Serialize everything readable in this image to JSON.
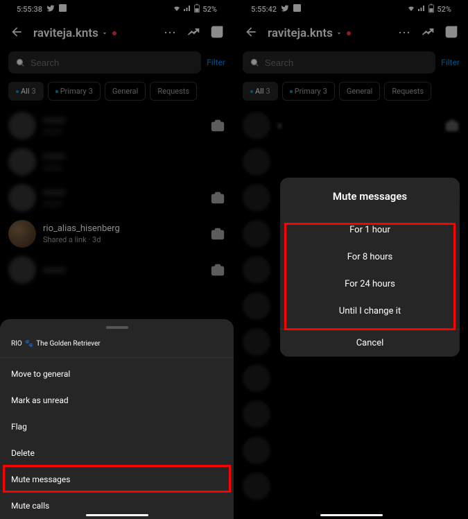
{
  "left": {
    "status": {
      "time": "5:55:38",
      "battery": "52%"
    },
    "header": {
      "username": "raviteja.knts"
    },
    "search": {
      "placeholder": "Search",
      "filter": "Filter"
    },
    "tabs": {
      "all": {
        "label": "All",
        "count": "3"
      },
      "primary": {
        "label": "Primary",
        "count": "3"
      },
      "general": {
        "label": "General"
      },
      "requests": {
        "label": "Requests"
      }
    },
    "visible_row": {
      "name": "rio_alias_hisenberg",
      "sub": "Shared a link · 3d"
    },
    "sheet": {
      "title_prefix": "RIO",
      "title_suffix": "The Golden Retriever",
      "items": {
        "move": "Move to general",
        "unread": "Mark as unread",
        "flag": "Flag",
        "delete": "Delete",
        "mute_msg": "Mute messages",
        "mute_calls": "Mute calls"
      }
    }
  },
  "right": {
    "status": {
      "time": "5:55:42",
      "battery": "52%"
    },
    "header": {
      "username": "raviteja.knts"
    },
    "search": {
      "placeholder": "Search",
      "filter": "Filter"
    },
    "tabs": {
      "all": {
        "label": "All",
        "count": "3"
      },
      "primary": {
        "label": "Primary",
        "count": "3"
      },
      "general": {
        "label": "General"
      },
      "requests": {
        "label": "Requests"
      }
    },
    "modal": {
      "title": "Mute messages",
      "opt1": "For 1 hour",
      "opt8": "For 8 hours",
      "opt24": "For 24 hours",
      "until": "Until I change it",
      "cancel": "Cancel"
    }
  }
}
